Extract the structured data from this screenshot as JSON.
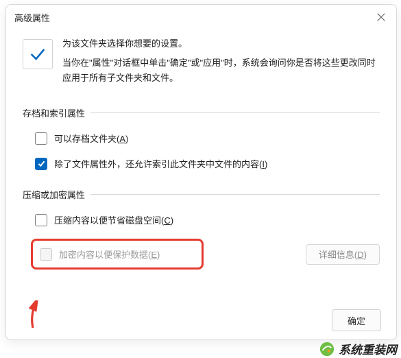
{
  "dialog": {
    "title": "高级属性",
    "intro_line1": "为该文件夹选择你想要的设置。",
    "intro_line2": "当你在\"属性\"对话框中单击\"确定\"或\"应用\"时，系统会询问你是否将这些更改同时应用于所有子文件夹和文件。"
  },
  "group_archive": {
    "title": "存档和索引属性",
    "opt_archive": "可以存档文件夹(",
    "opt_archive_hk": "A",
    "opt_archive_tail": ")",
    "opt_index": "除了文件属性外，还允许索引此文件夹中文件的内容(",
    "opt_index_hk": "I",
    "opt_index_tail": ")"
  },
  "group_compress": {
    "title": "压缩或加密属性",
    "opt_compress": "压缩内容以便节省磁盘空间(",
    "opt_compress_hk": "C",
    "opt_compress_tail": ")",
    "opt_encrypt": "加密内容以便保护数据(",
    "opt_encrypt_hk": "E",
    "opt_encrypt_tail": ")",
    "details_btn": "详细信息(",
    "details_btn_hk": "D",
    "details_btn_tail": ")"
  },
  "footer": {
    "ok": "确定"
  },
  "watermark": "系统重装网",
  "colors": {
    "accent": "#0067c0",
    "highlight_border": "#e43b2f"
  }
}
